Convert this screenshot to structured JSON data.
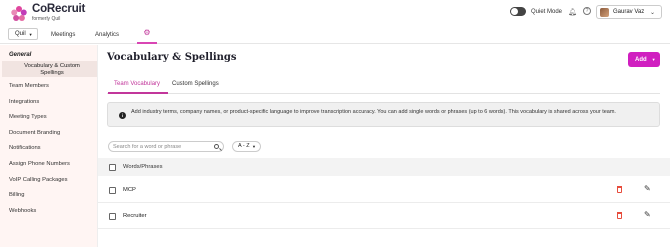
{
  "header": {
    "brand": "CoRecruit",
    "brand_sub": "formerly Quil",
    "quiet_mode_label": "Quiet Mode",
    "quiet_mode_on": false,
    "user_name": "Gaurav Vaz",
    "icons": [
      "bell-icon",
      "help-icon",
      "chevron-down-icon"
    ]
  },
  "nav": {
    "workspace": "Quil",
    "links": [
      "Meetings",
      "Analytics"
    ],
    "active_icon": "gear-icon"
  },
  "sidebar": {
    "section": "General",
    "active_item": "Vocabulary & Custom Spellings",
    "items": [
      "Team Members",
      "Integrations",
      "Meeting Types",
      "Document Branding",
      "Notifications",
      "Assign Phone Numbers",
      "VoIP Calling Packages",
      "Billing",
      "Webhooks"
    ]
  },
  "main": {
    "title": "Vocabulary & Spellings",
    "add_label": "Add",
    "tabs": [
      "Team Vocabulary",
      "Custom Spellings"
    ],
    "active_tab": "Team Vocabulary",
    "info_text": "Add industry terms, company names, or product-specific language to improve transcription accuracy. You can add single words or phrases (up to 6 words). This vocabulary is shared across your team.",
    "search_placeholder": "Search for a word or phrase",
    "sort_label": "A - Z",
    "table_header": "Words/Phrases",
    "rows": [
      "MCP",
      "Recruiter"
    ]
  },
  "colors": {
    "accent": "#d01fc0",
    "tab_accent": "#c2369b",
    "sidebar_bg": "#fff5f3",
    "delete": "#e74c3c"
  }
}
